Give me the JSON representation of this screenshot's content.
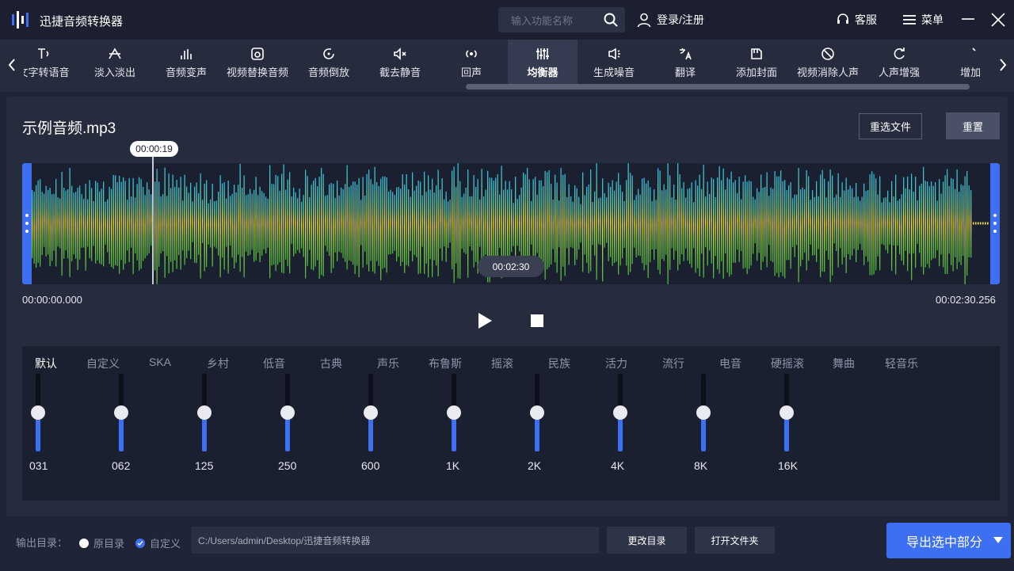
{
  "app": {
    "title": "迅捷音频转换器"
  },
  "titlebar": {
    "search_placeholder": "输入功能名称",
    "login": "登录/注册",
    "service": "客服",
    "menu": "菜单"
  },
  "tools": [
    {
      "label": "文字转语音",
      "icon": "text-to-speech-icon"
    },
    {
      "label": "淡入淡出",
      "icon": "fade-icon"
    },
    {
      "label": "音频变声",
      "icon": "voice-change-icon"
    },
    {
      "label": "视频替换音频",
      "icon": "video-replace-icon"
    },
    {
      "label": "音频倒放",
      "icon": "reverse-icon"
    },
    {
      "label": "截去静音",
      "icon": "mute-cut-icon"
    },
    {
      "label": "回声",
      "icon": "echo-icon"
    },
    {
      "label": "均衡器",
      "icon": "equalizer-icon",
      "active": true
    },
    {
      "label": "生成噪音",
      "icon": "noise-icon"
    },
    {
      "label": "翻译",
      "icon": "translate-icon"
    },
    {
      "label": "添加封面",
      "icon": "cover-icon"
    },
    {
      "label": "视频消除人声",
      "icon": "remove-vocal-icon"
    },
    {
      "label": "人声增强",
      "icon": "vocal-boost-icon"
    },
    {
      "label": "增加",
      "icon": "add-icon"
    }
  ],
  "file": {
    "name": "示例音频.mp3",
    "reselect_label": "重选文件",
    "reset_label": "重置"
  },
  "waveform": {
    "playhead_time": "00:00:19",
    "playhead_fraction": 0.128,
    "duration_badge": "00:02:30",
    "start_time": "00:00:00.000",
    "end_time": "00:02:30.256"
  },
  "equalizer": {
    "presets": [
      "默认",
      "自定义",
      "SKA",
      "乡村",
      "低音",
      "古典",
      "声乐",
      "布鲁斯",
      "摇滚",
      "民族",
      "活力",
      "流行",
      "电音",
      "硬摇滚",
      "舞曲",
      "轻音乐"
    ],
    "active_preset": "默认",
    "bands": [
      {
        "freq": "031",
        "level": 0.5
      },
      {
        "freq": "062",
        "level": 0.5
      },
      {
        "freq": "125",
        "level": 0.5
      },
      {
        "freq": "250",
        "level": 0.5
      },
      {
        "freq": "600",
        "level": 0.5
      },
      {
        "freq": "1K",
        "level": 0.5
      },
      {
        "freq": "2K",
        "level": 0.5
      },
      {
        "freq": "4K",
        "level": 0.5
      },
      {
        "freq": "8K",
        "level": 0.5
      },
      {
        "freq": "16K",
        "level": 0.5
      }
    ]
  },
  "output": {
    "label": "输出目录：",
    "option_original": "原目录",
    "option_custom": "自定义",
    "selected": "自定义",
    "path": "C:/Users/admin/Desktop/迅捷音频转换器",
    "change_dir_label": "更改目录",
    "open_folder_label": "打开文件夹",
    "export_label": "导出选中部分"
  },
  "colors": {
    "accent": "#3d6ff2",
    "background": "#1f2436",
    "panel": "#262b3e"
  }
}
